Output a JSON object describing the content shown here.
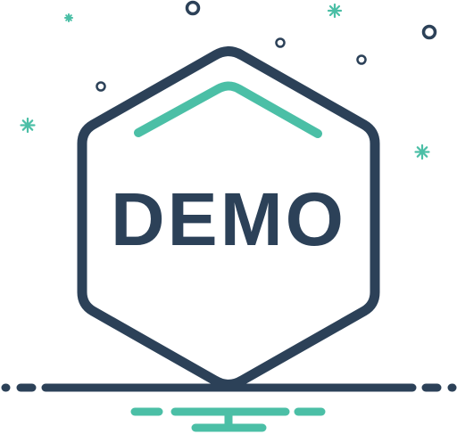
{
  "badge": {
    "label": "DEMO",
    "icon": "hexagon-badge-icon"
  },
  "colors": {
    "outline": "#2c4158",
    "accent": "#4bbfa6",
    "background": "#ffffff"
  }
}
